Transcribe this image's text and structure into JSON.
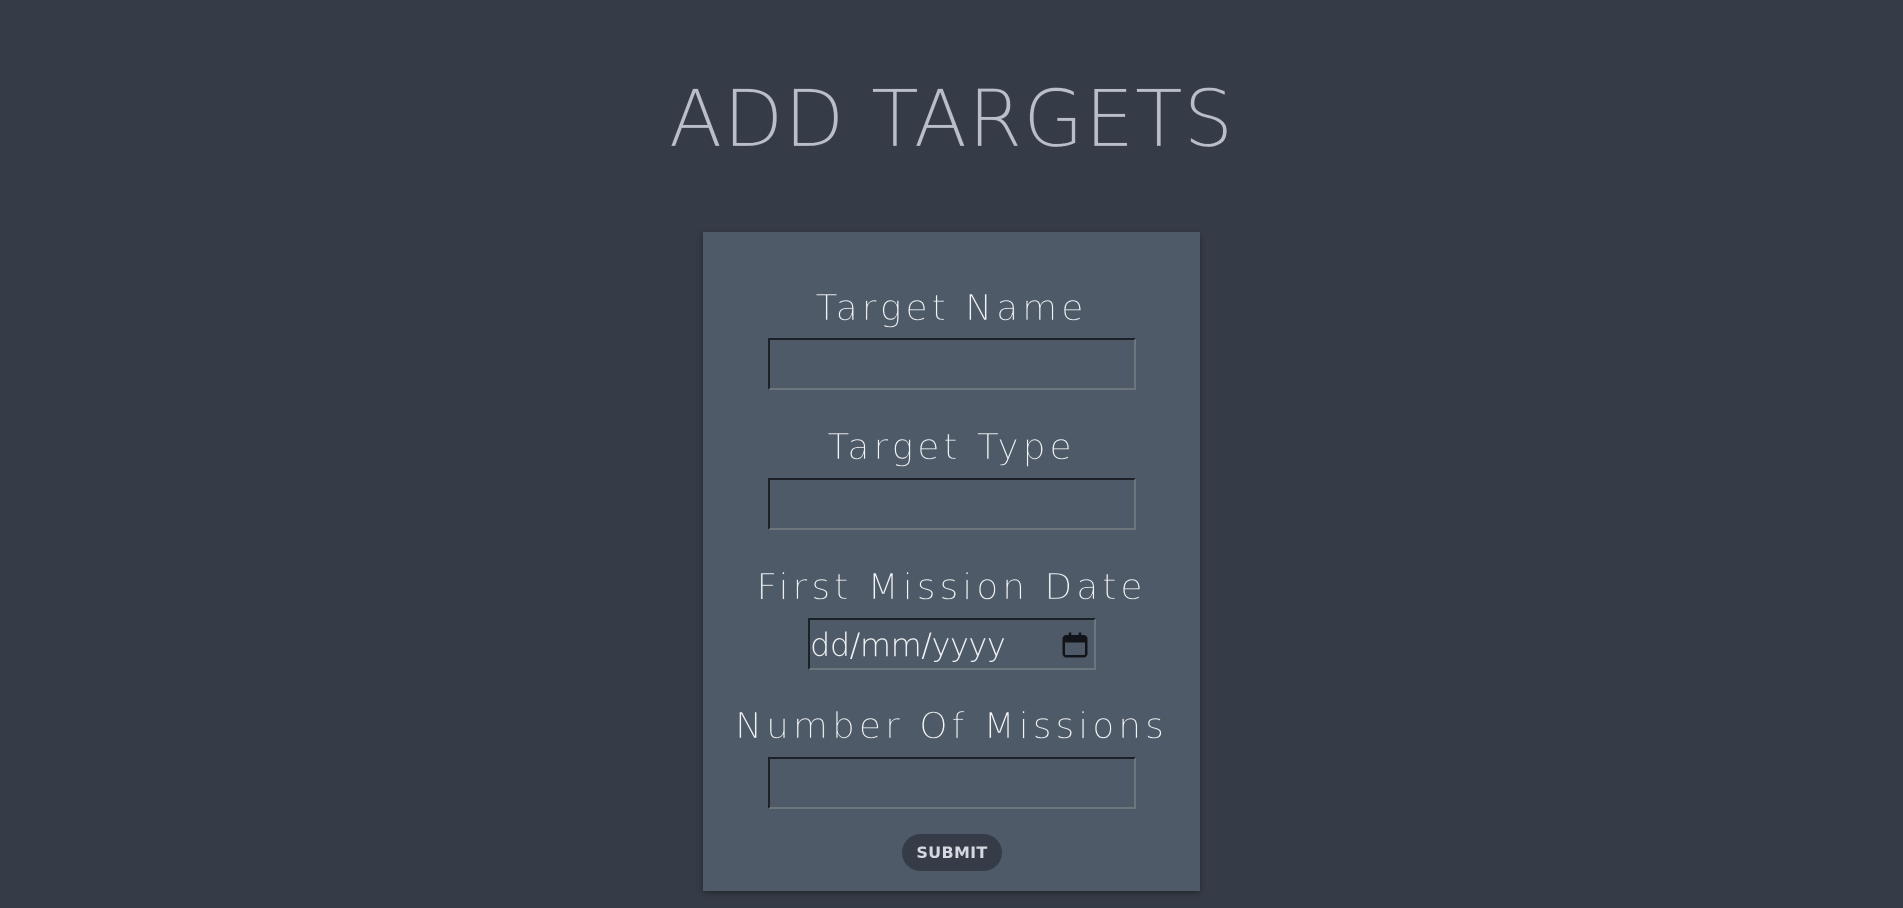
{
  "page": {
    "title": "ADD TARGETS"
  },
  "form": {
    "target_name": {
      "label": "Target Name",
      "value": ""
    },
    "target_type": {
      "label": "Target Type",
      "value": ""
    },
    "first_mission_date": {
      "label": "First Mission Date",
      "placeholder": "dd/mm/yyyy",
      "icon": "calendar-icon"
    },
    "number_of_missions": {
      "label": "Number Of Missions",
      "value": ""
    },
    "submit_label": "SUBMIT"
  },
  "colors": {
    "page_background": "#363c47",
    "card_background": "#4e5a67",
    "title_text": "#b9bec8",
    "label_text": "#f2f4f7",
    "button_background": "#363c47"
  }
}
